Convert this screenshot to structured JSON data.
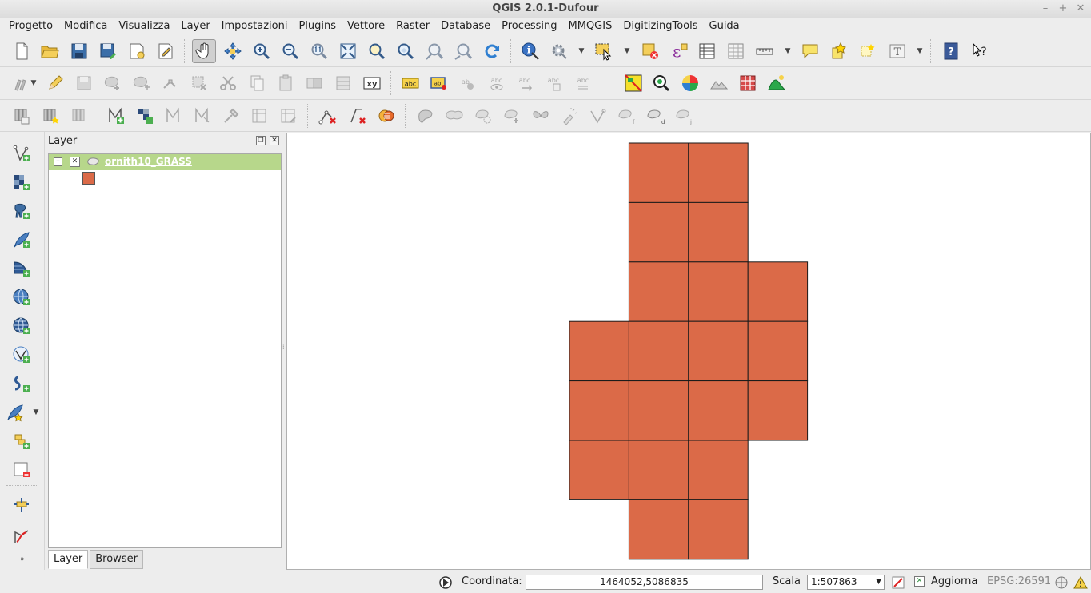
{
  "window": {
    "title": "QGIS 2.0.1-Dufour",
    "minimize": "–",
    "maximize": "+",
    "close": "✕"
  },
  "menu": [
    {
      "label": "Progetto"
    },
    {
      "label": "Modifica"
    },
    {
      "label": "Visualizza"
    },
    {
      "label": "Layer"
    },
    {
      "label": "Impostazioni"
    },
    {
      "label": "Plugins"
    },
    {
      "label": "Vettore"
    },
    {
      "label": "Raster"
    },
    {
      "label": "Database"
    },
    {
      "label": "Processing"
    },
    {
      "label": "MMQGIS"
    },
    {
      "label": "DigitizingTools"
    },
    {
      "label": "Guida"
    }
  ],
  "layer_panel": {
    "title": "Layer",
    "float_glyph": "❐",
    "close_glyph": "✕",
    "expand_glyph": "–",
    "check_glyph": "✕",
    "layers": [
      {
        "name": "ornith10_GRASS",
        "visible": true,
        "color": "#db6a48"
      }
    ],
    "tabs": [
      {
        "label": "Layer",
        "active": true
      },
      {
        "label": "Browser",
        "active": false
      }
    ]
  },
  "map": {
    "fill_color": "#db6a48",
    "stroke_color": "#1a1a1a",
    "columns": [
      {
        "col": 0,
        "rows": [
          3,
          4,
          5
        ]
      },
      {
        "col": 1,
        "rows": [
          0,
          1,
          2,
          3,
          4,
          5,
          6
        ]
      },
      {
        "col": 2,
        "rows": [
          0,
          1,
          2,
          3,
          4,
          5,
          6
        ]
      },
      {
        "col": 3,
        "rows": [
          2,
          3,
          4
        ]
      }
    ]
  },
  "status": {
    "coord_label": "Coordinata:",
    "coord_value": "1464052,5086835",
    "scale_label": "Scala",
    "scale_value": "1:507863",
    "render_label": "Aggiorna",
    "crs": "EPSG:26591"
  }
}
